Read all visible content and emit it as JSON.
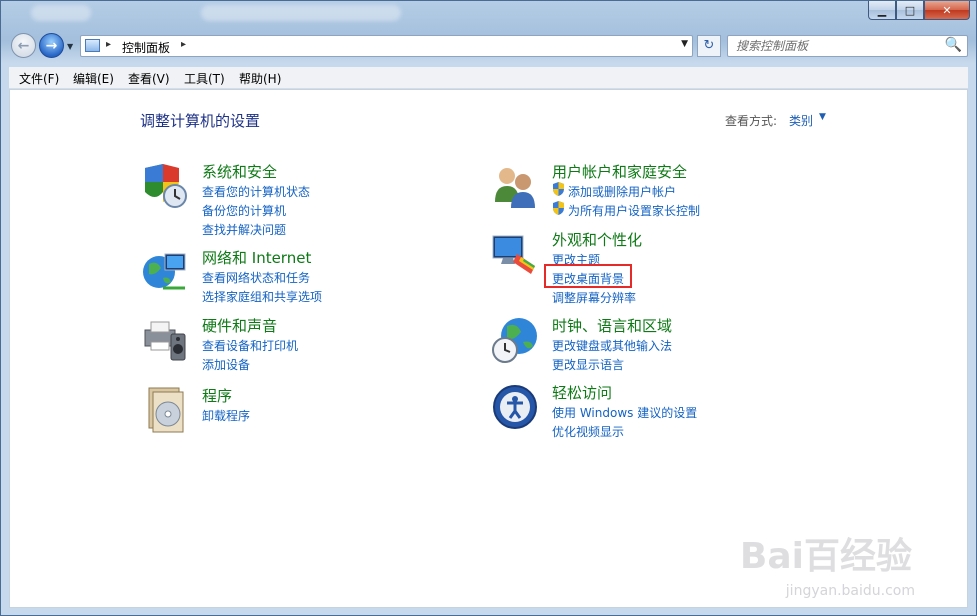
{
  "titlebar": {
    "minimize": "▁",
    "maximize": "□",
    "close": "✕"
  },
  "nav": {
    "back_icon": "arrow-left-icon",
    "forward_icon": "arrow-right-icon",
    "address": {
      "crumb": "控制面板",
      "separator": "▸",
      "dropdown": "▼"
    },
    "refresh_icon": "↻",
    "search": {
      "placeholder": "搜索控制面板",
      "icon": "🔍"
    }
  },
  "menu": [
    "文件(F)",
    "编辑(E)",
    "查看(V)",
    "工具(T)",
    "帮助(H)"
  ],
  "content": {
    "title": "调整计算机的设置",
    "view_by_label": "查看方式:",
    "view_by_value": "类别",
    "view_by_arrow": "▼",
    "categories_left": [
      {
        "title": "系统和安全",
        "icon": "shield-clock-icon",
        "links": [
          "查看您的计算机状态",
          "备份您的计算机",
          "查找并解决问题"
        ]
      },
      {
        "title": "网络和 Internet",
        "icon": "globe-network-icon",
        "links": [
          "查看网络状态和任务",
          "选择家庭组和共享选项"
        ]
      },
      {
        "title": "硬件和声音",
        "icon": "printer-speaker-icon",
        "links": [
          "查看设备和打印机",
          "添加设备"
        ]
      },
      {
        "title": "程序",
        "icon": "programs-disc-icon",
        "links": [
          "卸载程序"
        ]
      }
    ],
    "categories_right": [
      {
        "title": "用户帐户和家庭安全",
        "icon": "users-icon",
        "links": [
          "添加或删除用户帐户",
          "为所有用户设置家长控制"
        ]
      },
      {
        "title": "外观和个性化",
        "icon": "monitor-palette-icon",
        "links": [
          "更改主题",
          "更改桌面背景",
          "调整屏幕分辨率"
        ]
      },
      {
        "title": "时钟、语言和区域",
        "icon": "clock-globe-icon",
        "links": [
          "更改键盘或其他输入法",
          "更改显示语言"
        ]
      },
      {
        "title": "轻松访问",
        "icon": "accessibility-icon",
        "links": [
          "使用 Windows 建议的设置",
          "优化视频显示"
        ]
      }
    ]
  },
  "watermark": {
    "brand": "Bai百经验",
    "url": "jingyan.baidu.com"
  },
  "colors": {
    "category_title": "#0e7a16",
    "link": "#1463c4",
    "page_title": "#1e3287",
    "highlight": "#e52a2a"
  }
}
